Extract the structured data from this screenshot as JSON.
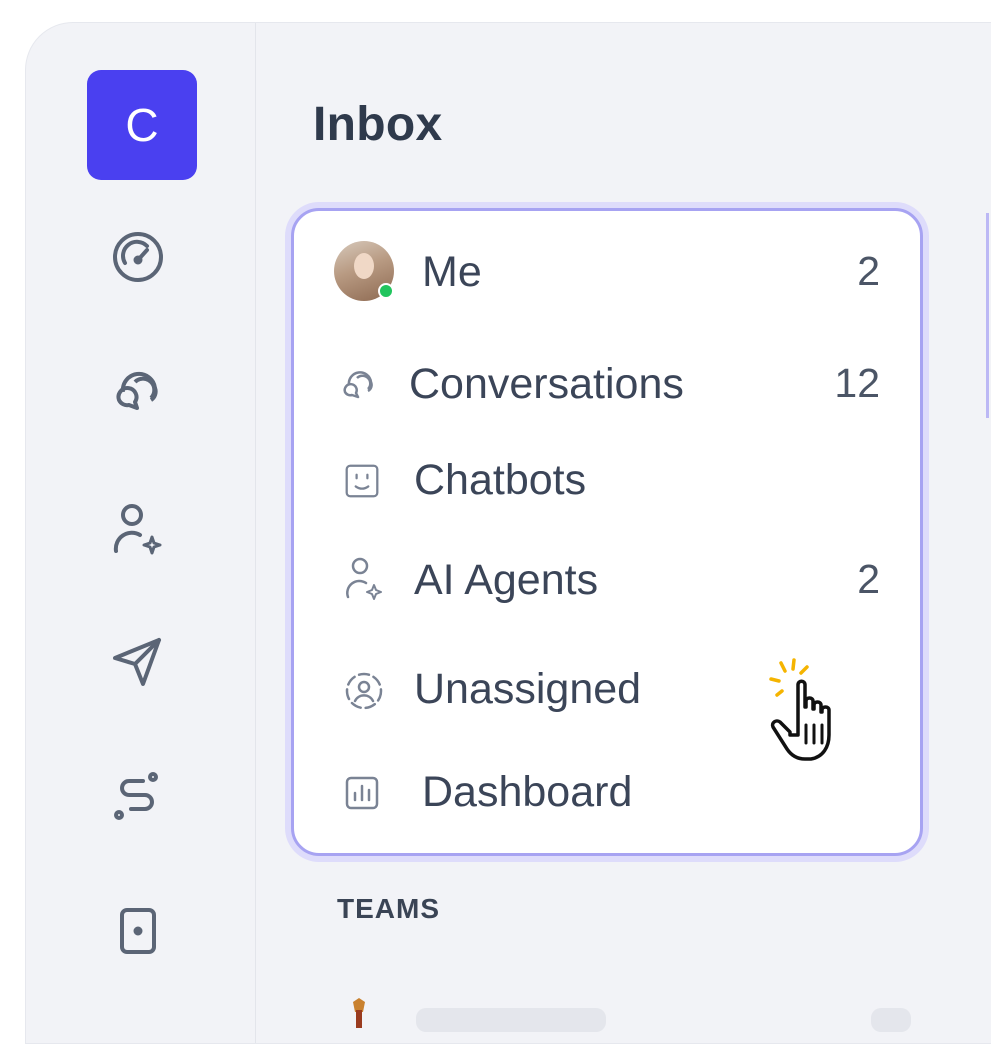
{
  "brand": {
    "letter": "C",
    "color": "#4a40f0"
  },
  "rail": {
    "icons": [
      {
        "name": "dashboard-gauge-icon"
      },
      {
        "name": "conversations-icon"
      },
      {
        "name": "ai-agent-icon"
      },
      {
        "name": "send-icon"
      },
      {
        "name": "workflow-icon"
      },
      {
        "name": "device-icon"
      }
    ]
  },
  "inbox": {
    "title": "Inbox",
    "items": [
      {
        "label": "Me",
        "count": "2",
        "icon": "avatar"
      },
      {
        "label": "Conversations",
        "count": "12",
        "icon": "conversations-icon"
      },
      {
        "label": "Chatbots",
        "count": "",
        "icon": "chatbot-icon"
      },
      {
        "label": "AI Agents",
        "count": "2",
        "icon": "ai-agent-icon"
      },
      {
        "label": "Unassigned",
        "count": "",
        "icon": "unassigned-icon"
      },
      {
        "label": "Dashboard",
        "count": "",
        "icon": "bar-chart-icon"
      }
    ]
  },
  "teams": {
    "label": "TEAMS"
  },
  "colors": {
    "accent": "#4a40f0",
    "highlight_border": "#a7a3f2",
    "presence": "#22c55e",
    "text": "#3b4558"
  }
}
